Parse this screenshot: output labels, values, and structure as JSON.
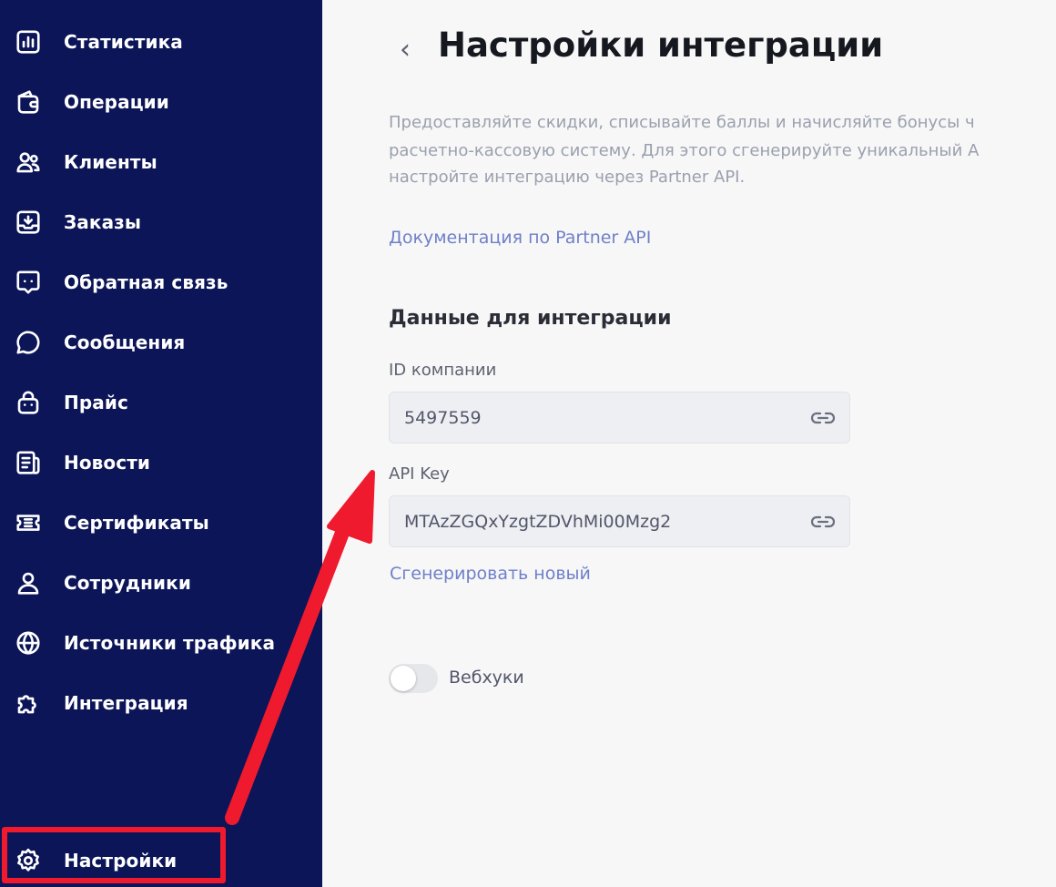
{
  "sidebar": {
    "items": [
      {
        "label": "Статистика",
        "icon": "bar-chart-icon"
      },
      {
        "label": "Операции",
        "icon": "wallet-icon"
      },
      {
        "label": "Клиенты",
        "icon": "users-icon"
      },
      {
        "label": "Заказы",
        "icon": "inbox-download-icon"
      },
      {
        "label": "Обратная связь",
        "icon": "feedback-icon"
      },
      {
        "label": "Сообщения",
        "icon": "chat-bubble-icon"
      },
      {
        "label": "Прайс",
        "icon": "shopping-bag-icon"
      },
      {
        "label": "Новости",
        "icon": "newspaper-icon"
      },
      {
        "label": "Сертификаты",
        "icon": "ticket-icon"
      },
      {
        "label": "Сотрудники",
        "icon": "user-icon"
      },
      {
        "label": "Источники трафика",
        "icon": "globe-icon"
      },
      {
        "label": "Интеграция",
        "icon": "puzzle-icon"
      }
    ],
    "settings": {
      "label": "Настройки",
      "icon": "gear-icon"
    },
    "highlight_color": "#ef1a2d",
    "background_color": "#0b1557"
  },
  "main": {
    "back_icon": "chevron-left-icon",
    "title": "Настройки интеграции",
    "description_lines": [
      "Предоставляйте скидки, списывайте баллы и начисляйте бонусы ч",
      "расчетно-кассовую систему. Для этого сгенерируйте уникальный А",
      "настройте интеграцию через Partner API."
    ],
    "doc_link": "Документация по Partner API",
    "section_title": "Данные для интеграции",
    "company_id": {
      "label": "ID компании",
      "value": "5497559",
      "icon": "link-icon"
    },
    "api_key": {
      "label": "API Key",
      "value": "MTAzZGQxYzgtZDVhMi00Mzg2",
      "icon": "link-icon"
    },
    "generate_link": "Сгенерировать новый",
    "webhooks": {
      "label": "Вебхуки",
      "enabled": false
    }
  },
  "colors": {
    "link": "#6f80c8",
    "annotation": "#ef1a2d"
  }
}
